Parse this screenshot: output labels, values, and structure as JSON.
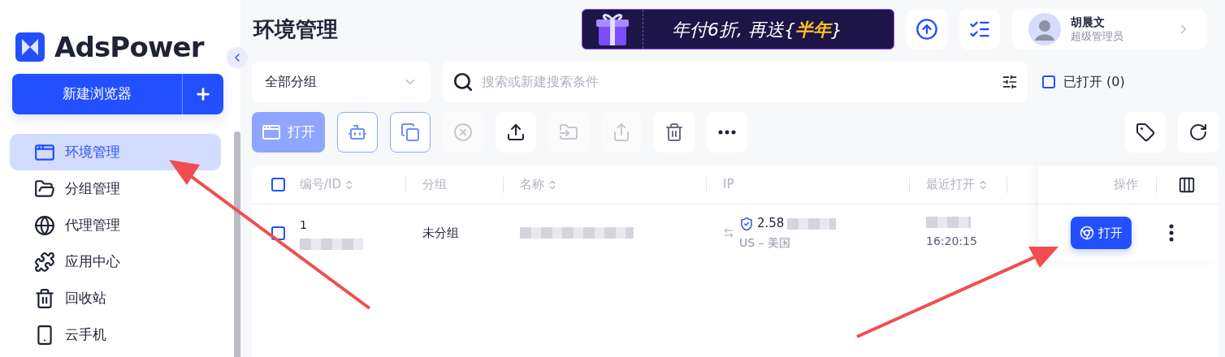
{
  "brand": {
    "name": "AdsPower"
  },
  "new_browser_button": "新建浏览器",
  "nav": [
    {
      "label": "环境管理",
      "selected": true
    },
    {
      "label": "分组管理",
      "selected": false
    },
    {
      "label": "代理管理",
      "selected": false
    },
    {
      "label": "应用中心",
      "selected": false
    },
    {
      "label": "回收站",
      "selected": false
    },
    {
      "label": "云手机",
      "selected": false
    }
  ],
  "page_title": "环境管理",
  "promo": {
    "text": "年付6折, 再送{",
    "highlight": "半年",
    "text_end": "}"
  },
  "user": {
    "name": "胡晨文",
    "role": "超级管理员"
  },
  "group_select": {
    "value": "全部分组"
  },
  "search": {
    "placeholder": "搜索或新建搜索条件"
  },
  "opened_filter": {
    "label": "已打开 (0)",
    "checked": false
  },
  "open_button": "打开",
  "tools": [
    {
      "disabled": false
    },
    {
      "disabled": false
    },
    {
      "disabled": true
    },
    {
      "disabled": false
    },
    {
      "disabled": true
    },
    {
      "disabled": true
    },
    {
      "disabled": false
    },
    {
      "disabled": false
    }
  ],
  "table": {
    "columns": [
      {
        "label": "编号/ID",
        "sortable": true
      },
      {
        "label": "分组",
        "sortable": false
      },
      {
        "label": "名称",
        "sortable": true
      },
      {
        "label": "IP",
        "sortable": false
      },
      {
        "label": "最近打开",
        "sortable": true
      }
    ],
    "select_all_checked": false,
    "action_column": "操作",
    "rows": [
      {
        "checked": false,
        "id": "1",
        "group": "未分组",
        "ip": "2.58",
        "location": "US – 美国",
        "last_open_time": "16:20:15",
        "open_label": "打开"
      }
    ]
  }
}
